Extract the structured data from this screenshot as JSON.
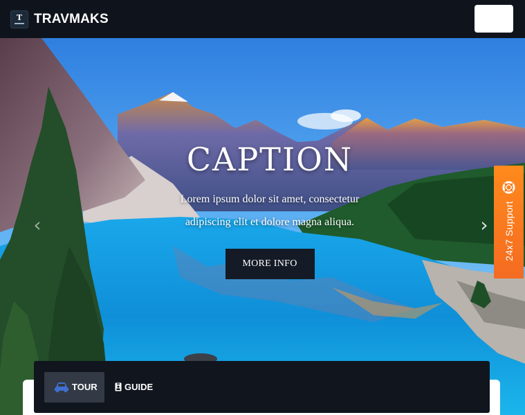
{
  "navbar": {
    "brand_name": "TRAVMAKS",
    "logo_letter": "T",
    "logo_icon": "travmaks-logo-icon",
    "toggler_icon": "menu-toggler"
  },
  "hero": {
    "caption_title": "CAPTION",
    "caption_text": "Lorem ipsum dolor sit amet, consectetur adipiscing elit et dolore magna aliqua.",
    "button_label": "MORE INFO",
    "prev_icon": "chevron-left-icon",
    "next_icon": "chevron-right-icon",
    "prev_glyph": "‹",
    "next_glyph": "›"
  },
  "support": {
    "label": "24x7 Support",
    "icon": "lifebuoy-icon",
    "color": "#f47c20"
  },
  "booking": {
    "tabs": [
      {
        "label": "TOUR",
        "icon": "car-icon",
        "active": true
      },
      {
        "label": "GUIDE",
        "icon": "id-badge-icon",
        "active": false
      }
    ]
  },
  "colors": {
    "navbar_bg": "#0f141c",
    "button_bg": "#151b26",
    "active_tab_bg": "#333a45",
    "car_icon": "#3f6fd0"
  }
}
